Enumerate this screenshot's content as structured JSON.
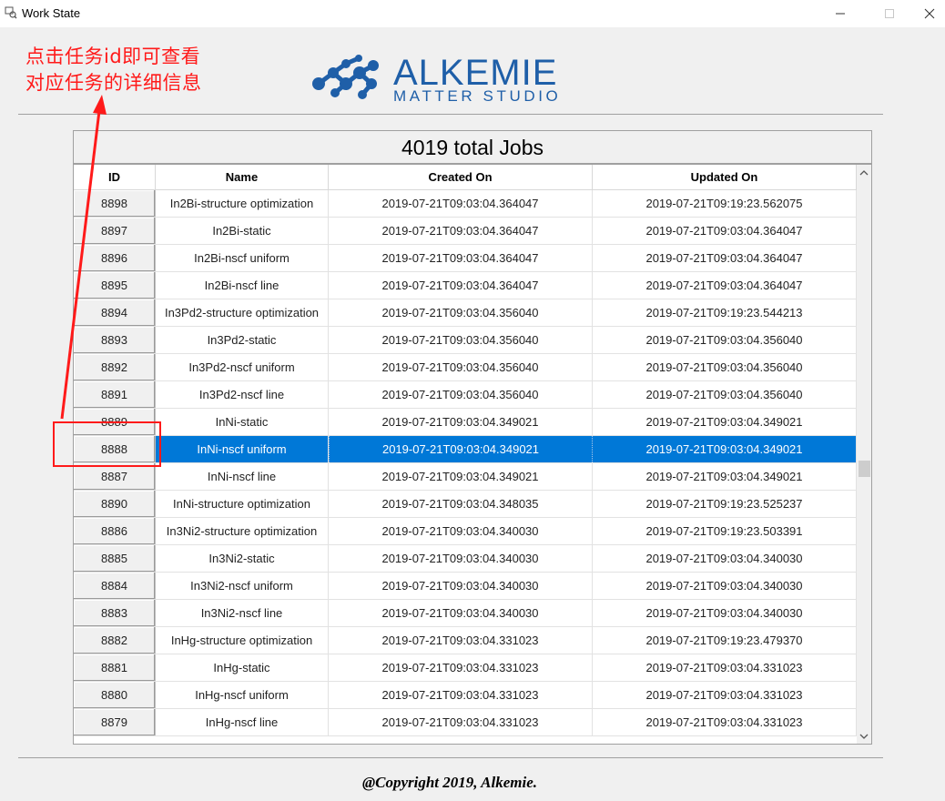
{
  "window": {
    "title": "Work State"
  },
  "annotation": {
    "lines": [
      "点击任务id即可查看",
      "对应任务的详细信息"
    ],
    "color": "#ff1a1a"
  },
  "logo": {
    "word": "ALKEMIE",
    "sub": "MATTER STUDIO",
    "color": "#1f5fa8"
  },
  "panel": {
    "title": "4019 total Jobs"
  },
  "table": {
    "columns": [
      "ID",
      "Name",
      "Created On",
      "Updated On"
    ],
    "rows": [
      {
        "id": "8898",
        "name": "In2Bi-structure optimization",
        "created": "2019-07-21T09:03:04.364047",
        "updated": "2019-07-21T09:19:23.562075"
      },
      {
        "id": "8897",
        "name": "In2Bi-static",
        "created": "2019-07-21T09:03:04.364047",
        "updated": "2019-07-21T09:03:04.364047"
      },
      {
        "id": "8896",
        "name": "In2Bi-nscf uniform",
        "created": "2019-07-21T09:03:04.364047",
        "updated": "2019-07-21T09:03:04.364047"
      },
      {
        "id": "8895",
        "name": "In2Bi-nscf line",
        "created": "2019-07-21T09:03:04.364047",
        "updated": "2019-07-21T09:03:04.364047"
      },
      {
        "id": "8894",
        "name": "In3Pd2-structure optimization",
        "created": "2019-07-21T09:03:04.356040",
        "updated": "2019-07-21T09:19:23.544213"
      },
      {
        "id": "8893",
        "name": "In3Pd2-static",
        "created": "2019-07-21T09:03:04.356040",
        "updated": "2019-07-21T09:03:04.356040"
      },
      {
        "id": "8892",
        "name": "In3Pd2-nscf uniform",
        "created": "2019-07-21T09:03:04.356040",
        "updated": "2019-07-21T09:03:04.356040"
      },
      {
        "id": "8891",
        "name": "In3Pd2-nscf line",
        "created": "2019-07-21T09:03:04.356040",
        "updated": "2019-07-21T09:03:04.356040"
      },
      {
        "id": "8889",
        "name": "InNi-static",
        "created": "2019-07-21T09:03:04.349021",
        "updated": "2019-07-21T09:03:04.349021"
      },
      {
        "id": "8888",
        "name": "InNi-nscf uniform",
        "created": "2019-07-21T09:03:04.349021",
        "updated": "2019-07-21T09:03:04.349021",
        "selected": true
      },
      {
        "id": "8887",
        "name": "InNi-nscf line",
        "created": "2019-07-21T09:03:04.349021",
        "updated": "2019-07-21T09:03:04.349021"
      },
      {
        "id": "8890",
        "name": "InNi-structure optimization",
        "created": "2019-07-21T09:03:04.348035",
        "updated": "2019-07-21T09:19:23.525237"
      },
      {
        "id": "8886",
        "name": "In3Ni2-structure optimization",
        "created": "2019-07-21T09:03:04.340030",
        "updated": "2019-07-21T09:19:23.503391"
      },
      {
        "id": "8885",
        "name": "In3Ni2-static",
        "created": "2019-07-21T09:03:04.340030",
        "updated": "2019-07-21T09:03:04.340030"
      },
      {
        "id": "8884",
        "name": "In3Ni2-nscf uniform",
        "created": "2019-07-21T09:03:04.340030",
        "updated": "2019-07-21T09:03:04.340030"
      },
      {
        "id": "8883",
        "name": "In3Ni2-nscf line",
        "created": "2019-07-21T09:03:04.340030",
        "updated": "2019-07-21T09:03:04.340030"
      },
      {
        "id": "8882",
        "name": "InHg-structure optimization",
        "created": "2019-07-21T09:03:04.331023",
        "updated": "2019-07-21T09:19:23.479370"
      },
      {
        "id": "8881",
        "name": "InHg-static",
        "created": "2019-07-21T09:03:04.331023",
        "updated": "2019-07-21T09:03:04.331023"
      },
      {
        "id": "8880",
        "name": "InHg-nscf uniform",
        "created": "2019-07-21T09:03:04.331023",
        "updated": "2019-07-21T09:03:04.331023"
      },
      {
        "id": "8879",
        "name": "InHg-nscf line",
        "created": "2019-07-21T09:03:04.331023",
        "updated": "2019-07-21T09:03:04.331023"
      }
    ]
  },
  "colors": {
    "selection": "#0078d7",
    "accent": "#1f5fa8"
  },
  "footer": {
    "copyright": "@Copyright 2019, Alkemie."
  }
}
